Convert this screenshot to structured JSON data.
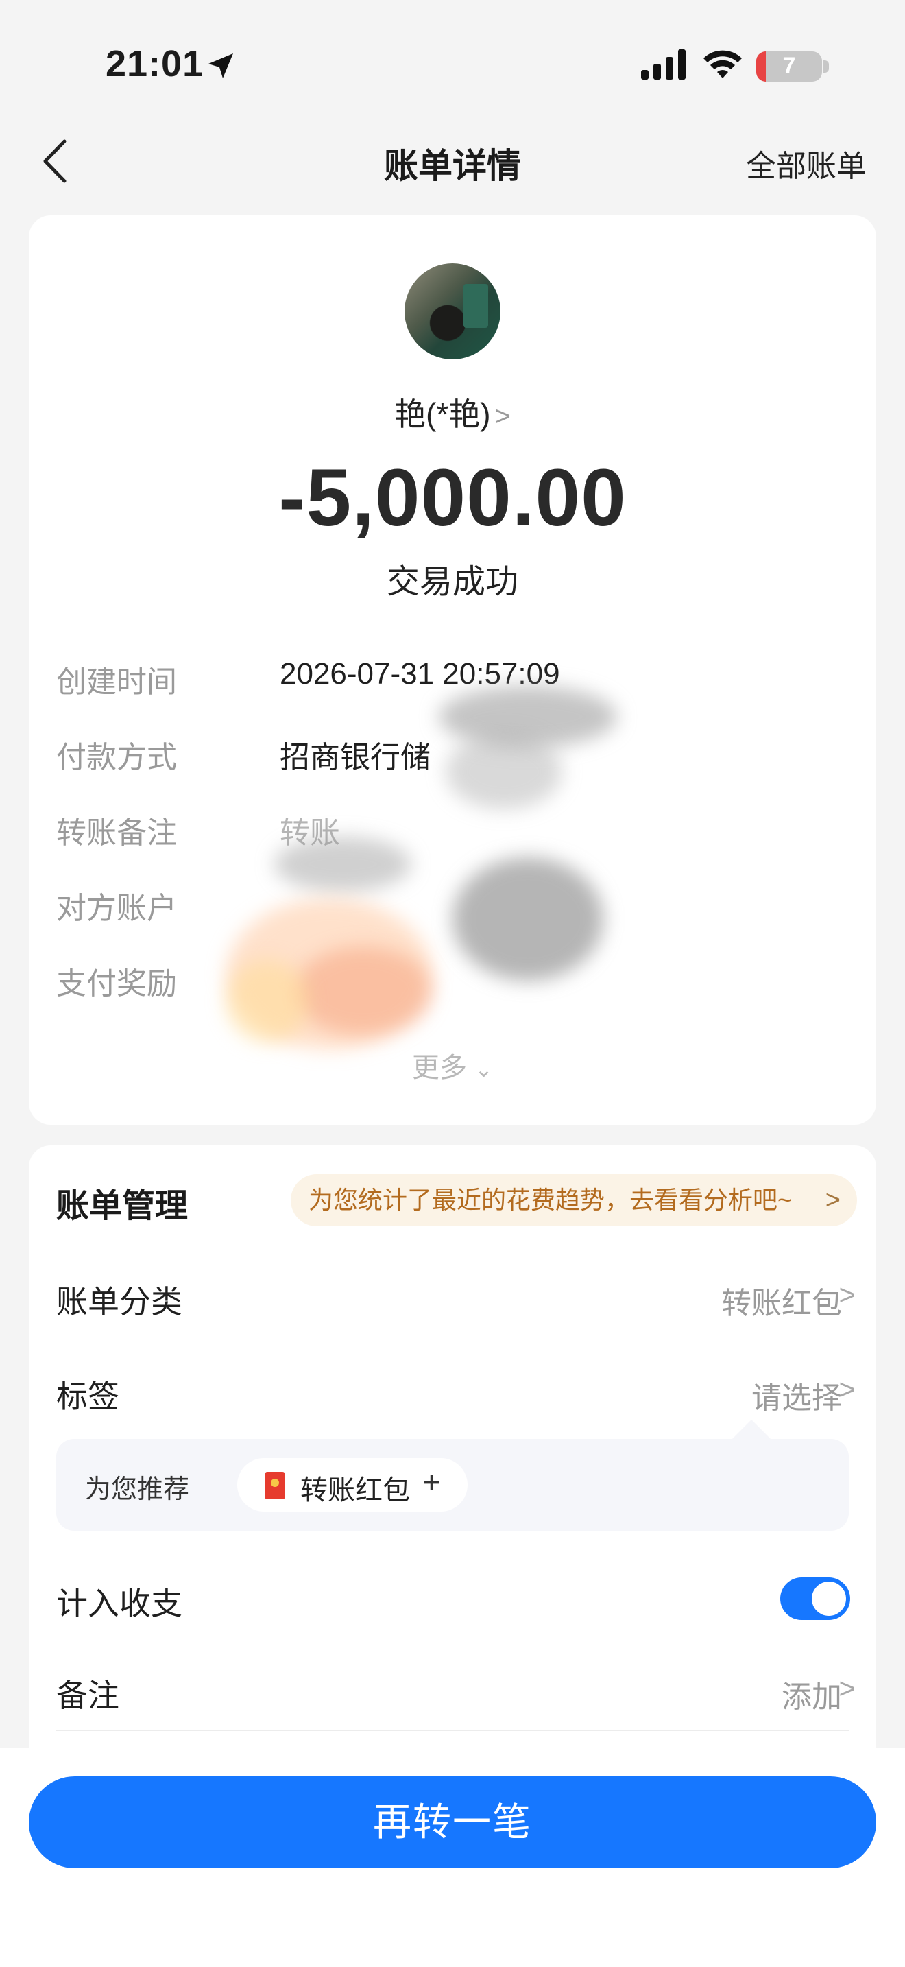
{
  "status_bar": {
    "time": "21:01",
    "battery": "7"
  },
  "nav": {
    "title": "账单详情",
    "all_bills": "全部账单"
  },
  "payee": {
    "name": "艳(*艳)",
    "amount": "-5,000.00",
    "status": "交易成功"
  },
  "details": {
    "rows": [
      {
        "label": "创建时间",
        "value": "2026-07-31 20:57:09"
      },
      {
        "label": "付款方式",
        "value": "招商银行储"
      },
      {
        "label": "转账备注",
        "value": "转账"
      },
      {
        "label": "对方账户",
        "value": ""
      },
      {
        "label": "支付奖励",
        "value": ""
      }
    ],
    "more": "更多"
  },
  "management": {
    "title": "账单管理",
    "hint": "为您统计了最近的花费趋势，去看看分析吧~",
    "category_label": "账单分类",
    "category_value": "转账红包",
    "tag_label": "标签",
    "tag_value": "请选择",
    "recommend_label": "为您推荐",
    "recommend_chip": "转账红包",
    "count_label": "计入收支",
    "count_enabled": true,
    "note_label": "备注",
    "note_value": "添加"
  },
  "actions": {
    "transfer_again": "再转一笔"
  },
  "colors": {
    "primary": "#1677ff",
    "hint_bg": "#fbf3e6",
    "hint_text": "#b36b1f"
  }
}
